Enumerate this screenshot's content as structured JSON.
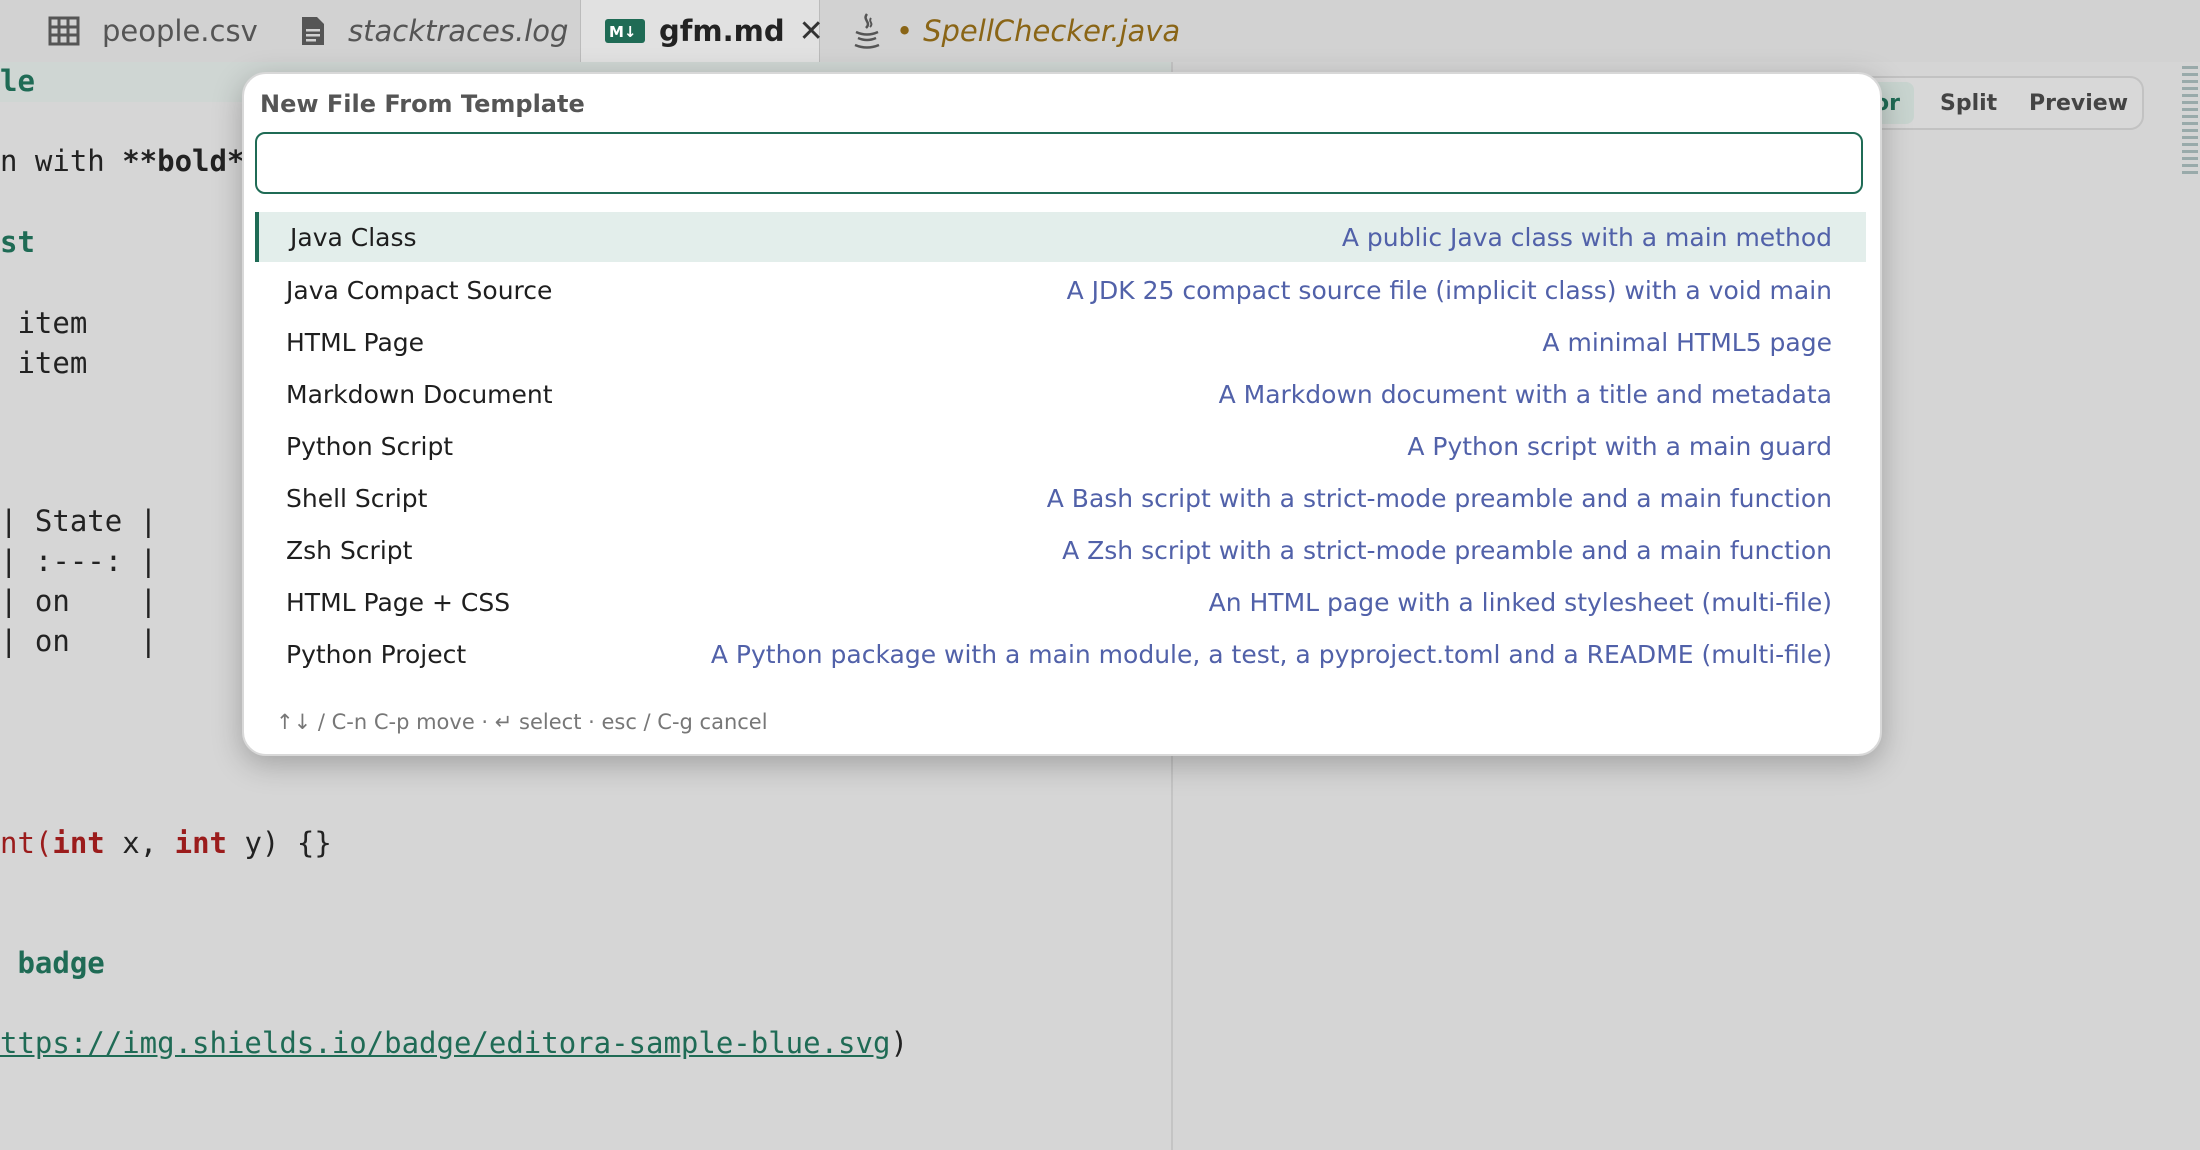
{
  "tabs": [
    {
      "label": "people.csv",
      "icon": "grid-icon"
    },
    {
      "label": "stacktraces.log",
      "icon": "document-icon"
    },
    {
      "label": "gfm.md",
      "icon": "markdown-icon",
      "active": true
    },
    {
      "label": "SpellChecker.java",
      "icon": "java-icon",
      "modified_marker": "•"
    }
  ],
  "editor": {
    "lines": {
      "l1": "le",
      "l2a": "n with ",
      "l2b": "**bold**",
      "l3": "st",
      "l4": " item",
      "l5": " item",
      "l6": "| State |",
      "l7": "| :---: |",
      "l8": "| on    |",
      "l9": "| on    |",
      "l10a": "nt(",
      "l10b": "int",
      "l10c": " x, ",
      "l10d": "int",
      "l10e": " y) {}",
      "l11": " badge",
      "l12a": "ttps://img.shields.io/badge/editora-sample-blue.svg",
      "l12b": ")"
    }
  },
  "view_modes": {
    "editor": "or",
    "split": "Split",
    "preview": "Preview"
  },
  "dialog": {
    "title": "New File From Template",
    "input_value": "",
    "templates": [
      {
        "name": "Java Class",
        "description": "A public Java class with a main method",
        "selected": true
      },
      {
        "name": "Java Compact Source",
        "description": "A JDK 25 compact source file (implicit class) with a void main"
      },
      {
        "name": "HTML Page",
        "description": "A minimal HTML5 page"
      },
      {
        "name": "Markdown Document",
        "description": "A Markdown document with a title and metadata"
      },
      {
        "name": "Python Script",
        "description": "A Python script with a main guard"
      },
      {
        "name": "Shell Script",
        "description": "A Bash script with a strict-mode preamble and a main function"
      },
      {
        "name": "Zsh Script",
        "description": "A Zsh script with a strict-mode preamble and a main function"
      },
      {
        "name": "HTML Page + CSS",
        "description": "An HTML page with a linked stylesheet (multi-file)"
      },
      {
        "name": "Python Project",
        "description": "A Python package with a main module, a test, a pyproject.toml and a README (multi-file)"
      }
    ],
    "hints": "↑↓ / C-n C-p move  ·  ↵ select  ·  esc / C-g cancel"
  },
  "colors": {
    "accent": "#1f6b55",
    "description": "#5161a9",
    "keyword": "#9b1c1c"
  }
}
